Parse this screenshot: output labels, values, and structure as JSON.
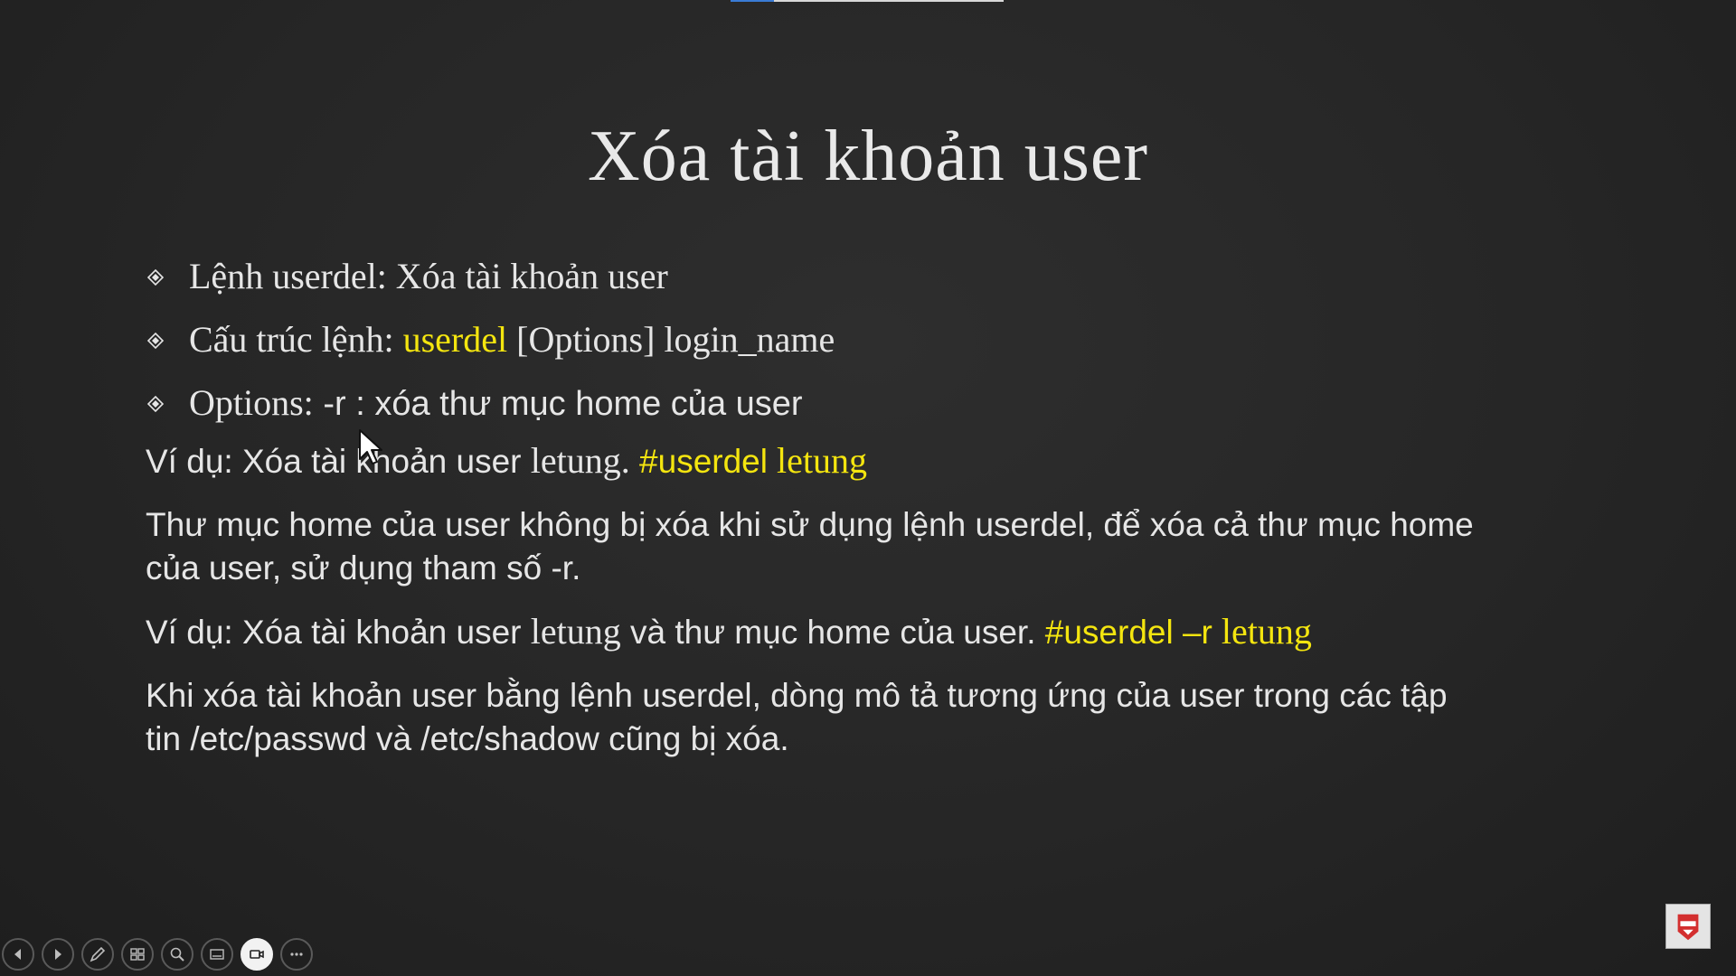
{
  "slide": {
    "title": "Xóa tài khoản user",
    "bullets": [
      {
        "parts": [
          "Lệnh userdel: Xóa tài khoản user"
        ]
      },
      {
        "prefix": "Cấu trúc lệnh: ",
        "highlight": "userdel",
        "suffix": " [Options] login_name"
      },
      {
        "prefix": "Options:",
        "sans": " -r : xóa thư mục home của user"
      }
    ],
    "example1": {
      "text": "Ví dụ: Xóa tài khoản user ",
      "name": "letung.",
      "cmd": "#userdel",
      "cmd_arg": " letung"
    },
    "note1": {
      "line1": "Thư mục home của user không bị xóa khi sử dụng lệnh userdel, để xóa cả thư mục home",
      "line2": "của user, sử dụng tham số -r."
    },
    "example2": {
      "text1": "Ví dụ: Xóa tài khoản user ",
      "name": "letung",
      "text2": " và thư mục home của user. ",
      "cmd": "#userdel –r",
      "cmd_arg": " letung"
    },
    "note2": {
      "line1": "Khi xóa tài khoản user bằng lệnh userdel, dòng mô tả tương ứng của user trong các tập",
      "line2": "tin /etc/passwd và /etc/shadow cũng bị xóa."
    }
  },
  "progress": {
    "fraction": 0.16,
    "fill_color": "#3a7bd5"
  },
  "controls": [
    {
      "icon": "previous-slide-icon"
    },
    {
      "icon": "next-slide-icon"
    },
    {
      "icon": "pen-icon"
    },
    {
      "icon": "all-slides-icon"
    },
    {
      "icon": "zoom-icon"
    },
    {
      "icon": "subtitles-icon"
    },
    {
      "icon": "camera-icon",
      "active": true
    },
    {
      "icon": "more-options-icon"
    }
  ],
  "colors": {
    "background": "#262626",
    "text": "#e6e6e6",
    "highlight": "#f4e50f"
  }
}
